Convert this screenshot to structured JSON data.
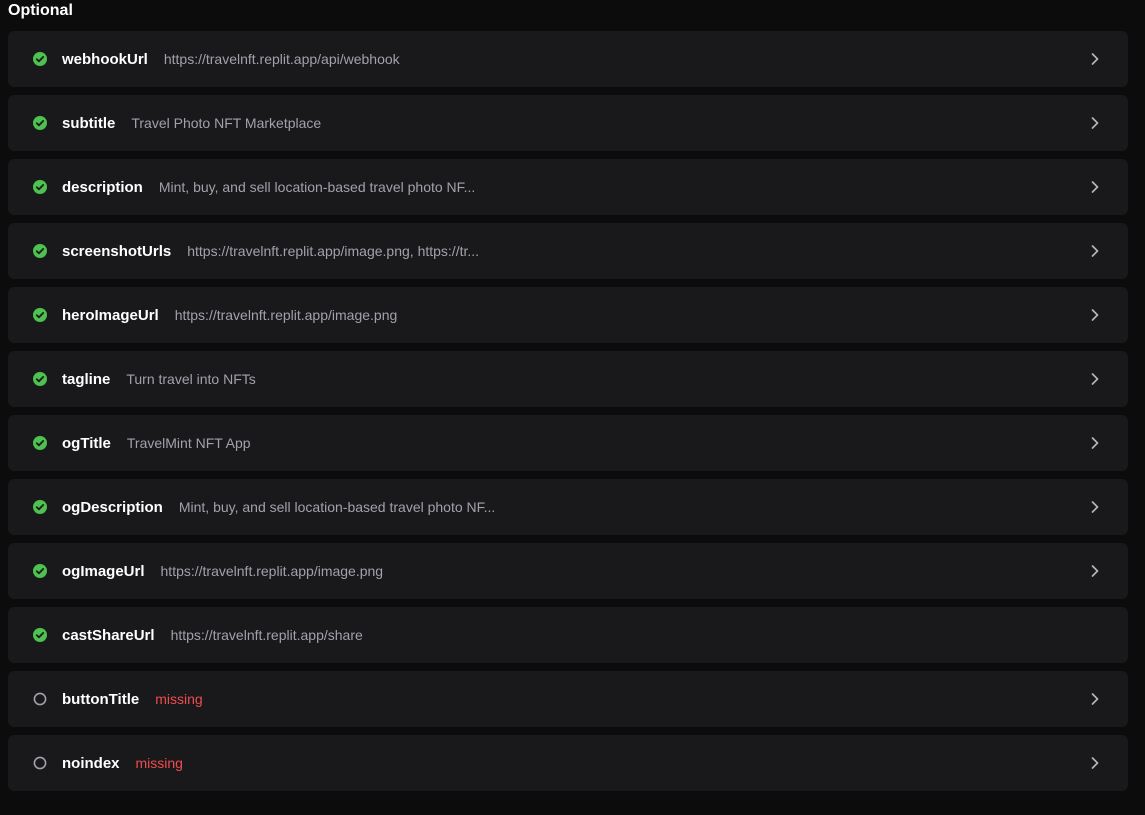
{
  "section": {
    "title": "Optional"
  },
  "colors": {
    "background": "#0c0c0d",
    "row_background": "#19191c",
    "ok": "#4ec24e",
    "missing": "#f04c4c",
    "value_text": "#a1a1aa"
  },
  "fields": [
    {
      "key": "webhookUrl",
      "value": "https://travelnft.replit.app/api/webhook",
      "status": "ok",
      "status_icon": "check-circle-icon",
      "has_chevron": true
    },
    {
      "key": "subtitle",
      "value": "Travel Photo NFT Marketplace",
      "status": "ok",
      "status_icon": "check-circle-icon",
      "has_chevron": true
    },
    {
      "key": "description",
      "value": "Mint, buy, and sell location-based travel photo NF...",
      "status": "ok",
      "status_icon": "check-circle-icon",
      "has_chevron": true
    },
    {
      "key": "screenshotUrls",
      "value": "https://travelnft.replit.app/image.png, https://tr...",
      "status": "ok",
      "status_icon": "check-circle-icon",
      "has_chevron": true
    },
    {
      "key": "heroImageUrl",
      "value": "https://travelnft.replit.app/image.png",
      "status": "ok",
      "status_icon": "check-circle-icon",
      "has_chevron": true
    },
    {
      "key": "tagline",
      "value": "Turn travel into NFTs",
      "status": "ok",
      "status_icon": "check-circle-icon",
      "has_chevron": true
    },
    {
      "key": "ogTitle",
      "value": "TravelMint NFT App",
      "status": "ok",
      "status_icon": "check-circle-icon",
      "has_chevron": true
    },
    {
      "key": "ogDescription",
      "value": "Mint, buy, and sell location-based travel photo NF...",
      "status": "ok",
      "status_icon": "check-circle-icon",
      "has_chevron": true
    },
    {
      "key": "ogImageUrl",
      "value": "https://travelnft.replit.app/image.png",
      "status": "ok",
      "status_icon": "check-circle-icon",
      "has_chevron": true
    },
    {
      "key": "castShareUrl",
      "value": "https://travelnft.replit.app/share",
      "status": "ok",
      "status_icon": "check-circle-icon",
      "has_chevron": false
    },
    {
      "key": "buttonTitle",
      "value": "missing",
      "status": "missing",
      "status_icon": "empty-circle-icon",
      "has_chevron": true
    },
    {
      "key": "noindex",
      "value": "missing",
      "status": "missing",
      "status_icon": "empty-circle-icon",
      "has_chevron": true
    }
  ]
}
